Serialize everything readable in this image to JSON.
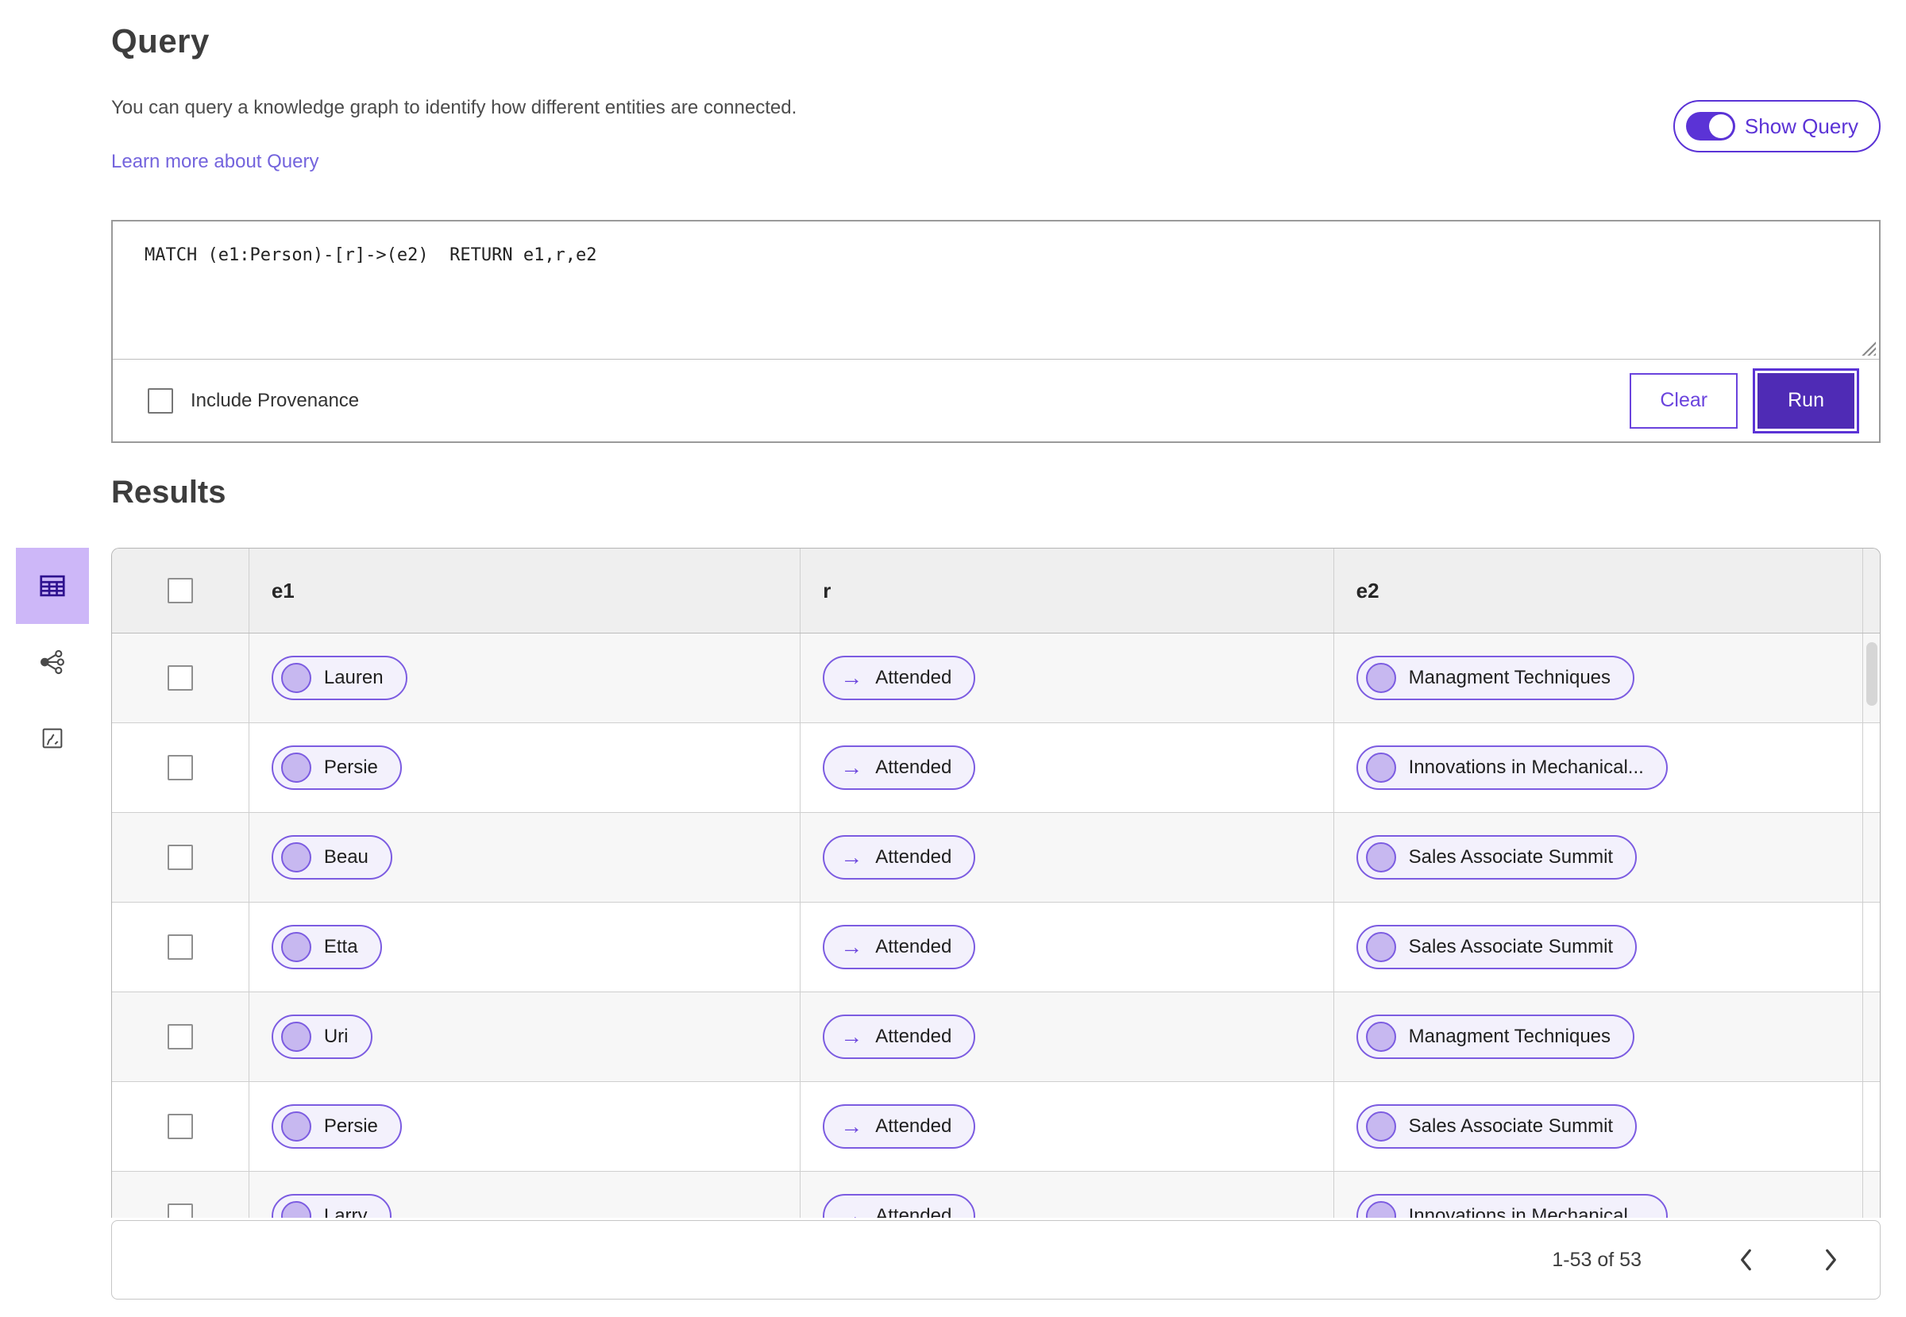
{
  "colors": {
    "accent": "#5b33d6",
    "run_fill": "#4f2bb5",
    "pill_border": "#7c5ce1",
    "pill_bg": "#f3f1fc",
    "pill_circle": "#c7b8f0",
    "link": "#7464dd",
    "selected_view_bg": "#cdb7f8",
    "selected_view_icon": "#2f128f"
  },
  "query_panel": {
    "title": "Query",
    "description": "You can query a knowledge graph to identify how different entities are connected.",
    "learn_more_label": "Learn more about Query",
    "show_query_label": "Show Query",
    "show_query_state": "on",
    "query_text": "MATCH (e1:Person)-[r]->(e2)  RETURN e1,r,e2",
    "include_provenance_label": "Include Provenance",
    "include_provenance_checked": false,
    "clear_label": "Clear",
    "run_label": "Run"
  },
  "view_switcher": {
    "items": [
      {
        "id": "table-view",
        "icon": "table-icon",
        "selected": true
      },
      {
        "id": "network-view",
        "icon": "network-icon",
        "selected": false
      },
      {
        "id": "chart-view",
        "icon": "chart-icon",
        "selected": false
      }
    ]
  },
  "results": {
    "title": "Results",
    "columns": {
      "e1": "e1",
      "r": "r",
      "e2": "e2"
    },
    "rows": [
      {
        "e1": "Lauren",
        "r": "Attended",
        "e2": "Managment Techniques"
      },
      {
        "e1": "Persie",
        "r": "Attended",
        "e2": "Innovations in Mechanical..."
      },
      {
        "e1": "Beau",
        "r": "Attended",
        "e2": "Sales Associate Summit"
      },
      {
        "e1": "Etta",
        "r": "Attended",
        "e2": "Sales Associate Summit"
      },
      {
        "e1": "Uri",
        "r": "Attended",
        "e2": "Managment Techniques"
      },
      {
        "e1": "Persie",
        "r": "Attended",
        "e2": "Sales Associate Summit"
      },
      {
        "e1": "Larry",
        "r": "Attended",
        "e2": "Innovations in Mechanical..."
      }
    ],
    "pagination": {
      "range_text": "1-53 of 53",
      "prev_icon": "chevron-left-icon",
      "next_icon": "chevron-right-icon"
    }
  }
}
